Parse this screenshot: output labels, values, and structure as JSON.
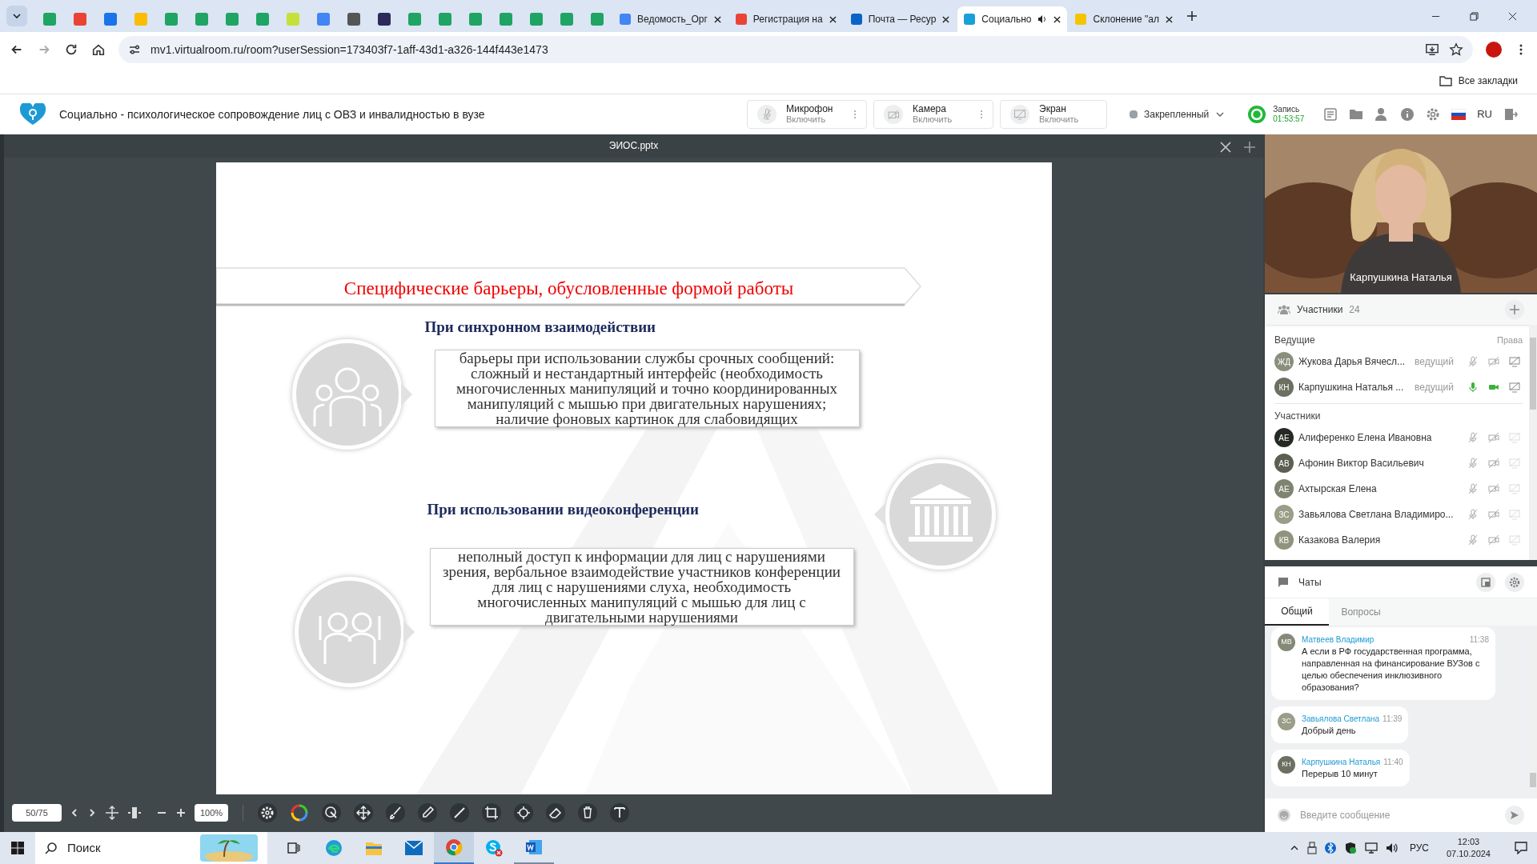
{
  "browser": {
    "tabs": [
      {
        "kind": "icon",
        "color": "#1fa463",
        "selected": false
      },
      {
        "kind": "icon",
        "color": "#ea4335",
        "selected": false
      },
      {
        "kind": "icon",
        "color": "#1a73e8",
        "selected": false
      },
      {
        "kind": "icon",
        "color": "#fbbc04",
        "selected": false
      },
      {
        "kind": "icon",
        "color": "#1fa463",
        "selected": false
      },
      {
        "kind": "icon",
        "color": "#1fa463",
        "selected": false
      },
      {
        "kind": "icon",
        "color": "#1fa463",
        "selected": false
      },
      {
        "kind": "icon",
        "color": "#1fa463",
        "selected": false
      },
      {
        "kind": "icon",
        "color": "#c6e03a",
        "selected": false
      },
      {
        "kind": "icon",
        "color": "#4285f4",
        "selected": false
      },
      {
        "kind": "icon",
        "color": "#555555",
        "selected": false
      },
      {
        "kind": "icon",
        "color": "#2d2a5a",
        "selected": false
      },
      {
        "kind": "icon",
        "color": "#1fa463",
        "selected": false
      },
      {
        "kind": "icon",
        "color": "#1fa463",
        "selected": false
      },
      {
        "kind": "icon",
        "color": "#1fa463",
        "selected": false
      },
      {
        "kind": "icon",
        "color": "#1fa463",
        "selected": false
      },
      {
        "kind": "icon",
        "color": "#1fa463",
        "selected": false
      },
      {
        "kind": "icon",
        "color": "#1fa463",
        "selected": false
      },
      {
        "kind": "icon",
        "color": "#1fa463",
        "selected": false
      },
      {
        "kind": "text",
        "color": "#4285f4",
        "title": "Ведомость_Орг",
        "selected": false
      },
      {
        "kind": "text",
        "color": "#ea4335",
        "title": "Регистрация на",
        "selected": false
      },
      {
        "kind": "text",
        "color": "#0a64c8",
        "title": "Почта — Ресур",
        "selected": false
      },
      {
        "kind": "text",
        "color": "#1aa0d8",
        "title": "Социально",
        "selected": true
      },
      {
        "kind": "text",
        "color": "#f5c400",
        "title": "Склонение \"ал",
        "selected": false
      }
    ],
    "url": "mv1.virtualroom.ru/room?userSession=173403f7-1aff-43d1-a326-144f443e1473",
    "bookmarks": "Все закладки"
  },
  "app": {
    "title": "Социально - психологическое сопровождение лиц с ОВЗ и инвалидностью в вузе",
    "controls": [
      {
        "kind": "mic",
        "label": "Микрофон",
        "sub": "Включить"
      },
      {
        "kind": "camera",
        "label": "Камера",
        "sub": "Включить"
      },
      {
        "kind": "screen",
        "label": "Экран",
        "sub": "Включить"
      }
    ],
    "pinned": "Закрепленный",
    "record": {
      "label": "Запись",
      "time": "01:53:57"
    },
    "lang": "RU"
  },
  "presentation": {
    "file": "ЭИОС.pptx",
    "slide": {
      "title": "Специфические барьеры, обусловленные формой работы",
      "sections": [
        {
          "heading": "При синхронном взаимодействии",
          "body": "барьеры при использовании службы срочных сообщений: сложный и нестандартный интерфейс (необходимость многочисленных манипуляций и точно координированных манипуляций с мышью при двигательных нарушениях; наличие фоновых картинок для слабовидящих"
        },
        {
          "heading": "При использовании видеоконференции",
          "body": "неполный доступ к информации для лиц с нарушениями зрения, вербальное взаимодействие участников конференции для лиц с нарушениями слуха, необходимость многочисленных манипуляций с мышью для лиц с двигательными нарушениями"
        }
      ]
    },
    "page": "50/75",
    "zoom": "100%"
  },
  "video": {
    "kind": "picture",
    "name": "Карпушкина Наталья"
  },
  "participants": {
    "title": "Участники",
    "count": "24",
    "hosts_label": "Ведущие",
    "rights_label": "Права",
    "hosts": [
      {
        "initials": "ЖД",
        "name": "Жукова Дарья Вячесл...",
        "role": "ведущий",
        "color": "#8a8f7c",
        "mic_on": false,
        "cam_on": false
      },
      {
        "initials": "КН",
        "name": "Карпушкина Наталья ...",
        "role": "ведущий",
        "color": "#6b7060",
        "mic_on": true,
        "cam_on": true
      }
    ],
    "members_label": "Участники",
    "members": [
      {
        "initials": "АЕ",
        "name": "Алиференко Елена Ивановна",
        "color": "#262a24",
        "mic_on": false,
        "cam_on": false
      },
      {
        "initials": "АВ",
        "name": "Афонин Виктор Васильевич",
        "color": "#5b6050",
        "mic_on": false,
        "cam_on": false
      },
      {
        "initials": "АЕ",
        "name": "Ахтырская Елена",
        "color": "#7e8470",
        "mic_on": false,
        "cam_on": false
      },
      {
        "initials": "ЗС",
        "name": "Завьялова Светлана Владимиро...",
        "color": "#9a9d88",
        "mic_on": false,
        "cam_on": false
      },
      {
        "initials": "КВ",
        "name": "Казакова Валерия",
        "color": "#8f947c",
        "mic_on": false,
        "cam_on": false
      }
    ]
  },
  "chat": {
    "title": "Чаты",
    "tabs": [
      {
        "label": "Общий",
        "selected": true
      },
      {
        "label": "Вопросы",
        "selected": false
      }
    ],
    "messages": [
      {
        "initials": "МВ",
        "color": "#858a78",
        "author": "Матвеев Владимир",
        "time": "11:38",
        "text": "А если в РФ государственная программа, направленная на финансирование ВУЗов с целью обеспечения инклюзивного образования?"
      },
      {
        "initials": "ЗС",
        "color": "#9a9d88",
        "author": "Завьялова Светлана",
        "time": "11:39",
        "text": "Добрый день"
      },
      {
        "initials": "КН",
        "color": "#6b7060",
        "author": "Карпушкина Наталья",
        "time": "11:40",
        "text": "Перерыв 10 минут"
      }
    ],
    "placeholder": "Введите сообщение"
  },
  "taskbar": {
    "search": "Поиск",
    "lang": "РУС",
    "time": "12:03",
    "date": "07.10.2024"
  }
}
